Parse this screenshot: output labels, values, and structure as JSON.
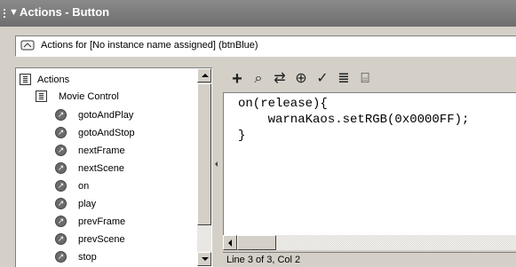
{
  "panel": {
    "title": "Actions - Button"
  },
  "instance": {
    "label": "Actions for [No instance name assigned] (btnBlue)"
  },
  "tree": {
    "root": {
      "label": "Actions"
    },
    "group": {
      "label": "Movie Control"
    },
    "items": [
      {
        "label": "gotoAndPlay"
      },
      {
        "label": "gotoAndStop"
      },
      {
        "label": "nextFrame"
      },
      {
        "label": "nextScene"
      },
      {
        "label": "on"
      },
      {
        "label": "play"
      },
      {
        "label": "prevFrame"
      },
      {
        "label": "prevScene"
      },
      {
        "label": "stop"
      }
    ]
  },
  "toolbar": {
    "add": "+",
    "find": "⌕",
    "replace": "⇄",
    "insert_target": "⊕",
    "check_syntax": "✓",
    "auto_format": "≣",
    "show_hints": "⌸"
  },
  "code": {
    "lines": [
      "on(release){",
      "    warnaKaos.setRGB(0x0000FF);",
      "}"
    ]
  },
  "status": {
    "text": "Line 3 of 3, Col 2"
  }
}
